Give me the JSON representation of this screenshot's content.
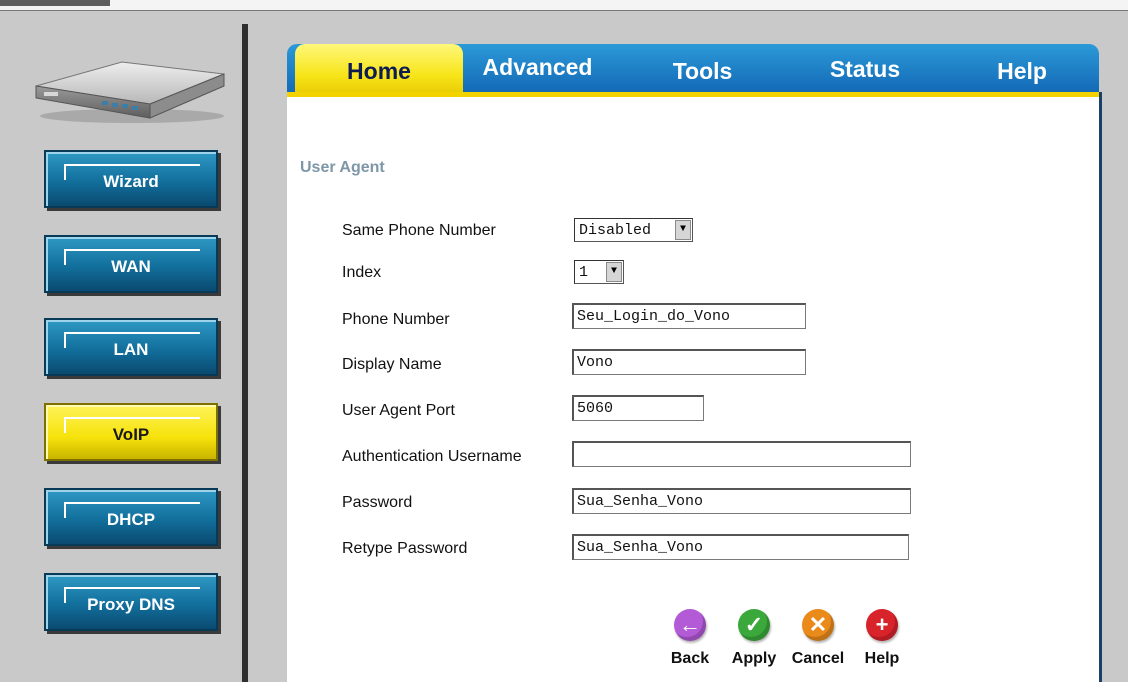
{
  "tabs": [
    "Home",
    "Advanced",
    "Tools",
    "Status",
    "Help"
  ],
  "active_tab": "Home",
  "sidebar": {
    "items": [
      {
        "label": "Wizard"
      },
      {
        "label": "WAN"
      },
      {
        "label": "LAN"
      },
      {
        "label": "VoIP"
      },
      {
        "label": "DHCP"
      },
      {
        "label": "Proxy DNS"
      }
    ],
    "active": "VoIP"
  },
  "section_title": "User Agent",
  "form": {
    "same_phone_label": "Same Phone Number",
    "same_phone_value": "Disabled",
    "index_label": "Index",
    "index_value": "1",
    "phone_label": "Phone Number",
    "phone_value": "Seu_Login_do_Vono",
    "display_label": "Display Name",
    "display_value": "Vono",
    "port_label": "User Agent Port",
    "port_value": "5060",
    "auth_label": "Authentication Username",
    "auth_value": "",
    "pass_label": "Password",
    "pass_value": "Sua_Senha_Vono",
    "retype_label": "Retype Password",
    "retype_value": "Sua_Senha_Vono"
  },
  "actions": {
    "back": "Back",
    "apply": "Apply",
    "cancel": "Cancel",
    "help": "Help"
  },
  "colors": {
    "tab_blue": "#1266b3",
    "tab_active": "#f7e51a",
    "nav_blue": "#126f9c",
    "nav_active": "#f6e20a",
    "back_icon": "#b35ad6",
    "apply_icon": "#3aa83a",
    "cancel_icon": "#ea8a1a",
    "help_icon": "#d8232a"
  }
}
